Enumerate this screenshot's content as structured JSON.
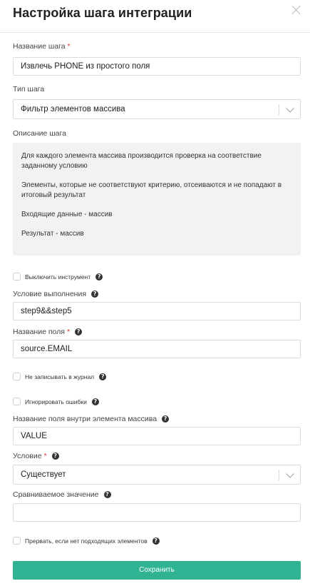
{
  "header": {
    "title": "Настройка шага интеграции"
  },
  "fields": {
    "step_name_label": "Название шага",
    "step_name_value": "Извлечь PHONE из простого поля",
    "step_type_label": "Тип шага",
    "step_type_value": "Фильтр элементов массива",
    "description_label": "Описание шага",
    "description_paragraphs": [
      "Для каждого элемента массива производится проверка на соответствие заданному условию",
      "Элементы, которые не соответствуют критерию, отсеиваются и не попадают в итоговый результат",
      "Входящие данные - массив",
      "Результат - массив"
    ],
    "disable_tool_label": "Выключить инструмент",
    "execution_condition_label": "Условие выполнения",
    "execution_condition_value": "step9&&step5",
    "field_name_label": "Название поля",
    "field_name_value": "source.EMAIL",
    "no_log_label": "Не записывать в журнал",
    "ignore_errors_label": "Игнорировать ошибки",
    "inner_field_label": "Название поля внутри элемента массива",
    "inner_field_value": "VALUE",
    "condition_label": "Условие",
    "condition_value": "Существует",
    "compare_value_label": "Сравниваемое значение",
    "compare_value_value": "",
    "abort_label": "Прервать, если нет подходящих элементов"
  },
  "required_mark": "*",
  "help_glyph": "?",
  "actions": {
    "save_label": "Сохранить"
  },
  "colors": {
    "accent": "#2fb393",
    "required": "#e53935"
  }
}
